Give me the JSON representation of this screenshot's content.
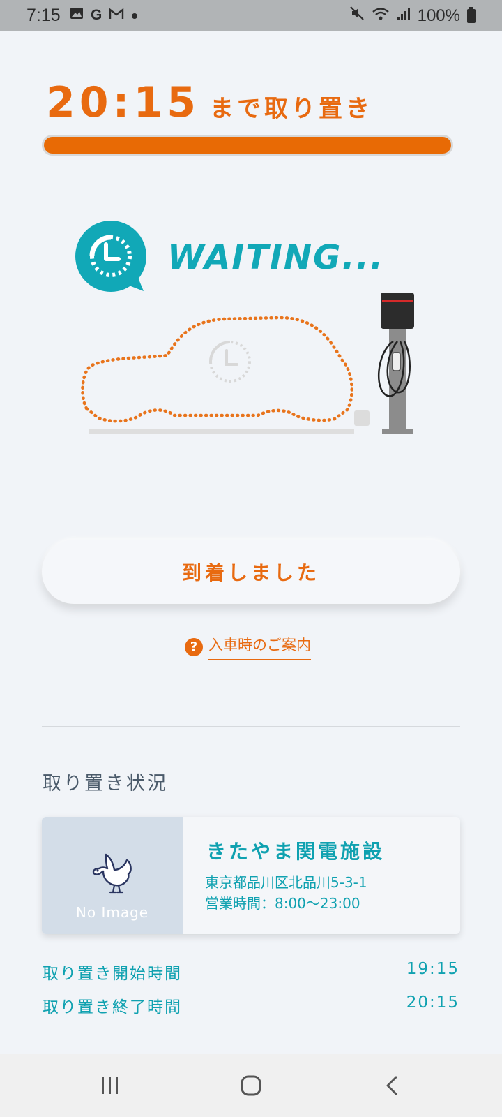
{
  "status_bar": {
    "time": "7:15",
    "battery": "100%"
  },
  "reservation": {
    "deadline_time": "20:15",
    "deadline_suffix": "まで取り置き",
    "remaining_fraction": 1.0
  },
  "illustration": {
    "waiting_label": "WAITING..."
  },
  "actions": {
    "arrived_button": "到着しました",
    "guide_link": "入車時のご案内",
    "guide_icon_glyph": "?"
  },
  "status_section": {
    "title": "取り置き状況",
    "facility": {
      "image_placeholder": "No Image",
      "name": "きたやま関電施設",
      "address": "東京都品川区北品川5-3-1",
      "hours": "営業時間：8:00〜23:00"
    },
    "rows": [
      {
        "label": "取り置き開始時間",
        "value": "19:15"
      },
      {
        "label": "取り置き終了時間",
        "value": "20:15"
      }
    ]
  },
  "colors": {
    "accent_orange": "#e86a10",
    "teal": "#0fa1b0",
    "background": "#f1f4f8"
  }
}
